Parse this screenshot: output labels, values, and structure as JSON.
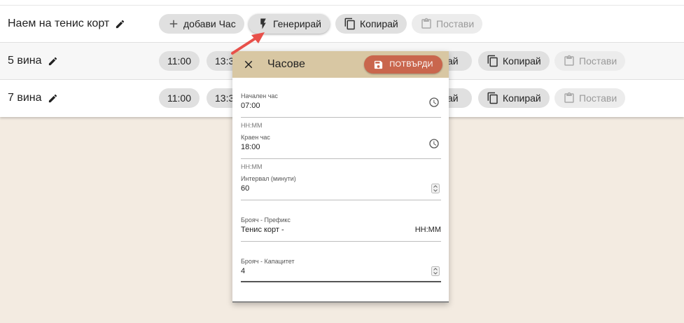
{
  "rows": [
    {
      "title": "Наем на тенис корт",
      "add_label": "добави Час",
      "generate_label": "Генерирай",
      "copy_label": "Копирай",
      "paste_label": "Постави"
    },
    {
      "title": "5 вина",
      "times": [
        "11:00",
        "13:3"
      ],
      "partial_label": "ай",
      "copy_label": "Копирай",
      "paste_label": "Постави"
    },
    {
      "title": "7 вина",
      "times": [
        "11:00",
        "13:3"
      ],
      "partial_label": "ай",
      "copy_label": "Копирай",
      "paste_label": "Постави"
    }
  ],
  "dialog": {
    "title": "Часове",
    "confirm_label": "ПОТВЪРДИ",
    "fields": {
      "start": {
        "label": "Начален час",
        "value": "07:00",
        "hint": "HH:MM"
      },
      "end": {
        "label": "Краен час",
        "value": "18:00",
        "hint": "HH:MM"
      },
      "interval": {
        "label": "Интервал (минути)",
        "value": "60"
      },
      "prefix": {
        "label": "Брояч - Префикс",
        "value": "Тенис корт -",
        "suffix": "HH:MM"
      },
      "capacity": {
        "label": "Брояч - Капацитет",
        "value": "4"
      }
    }
  },
  "colors": {
    "dialog_header": "#d8c7a3",
    "confirm_button": "#c9664d",
    "annotation_arrow": "#e8504a",
    "background": "#f3ebe1"
  },
  "icons": [
    "pencil-icon",
    "plus-icon",
    "lightning-icon",
    "copy-icon",
    "clipboard-icon",
    "close-icon",
    "save-icon",
    "clock-icon",
    "spinner-icon"
  ]
}
